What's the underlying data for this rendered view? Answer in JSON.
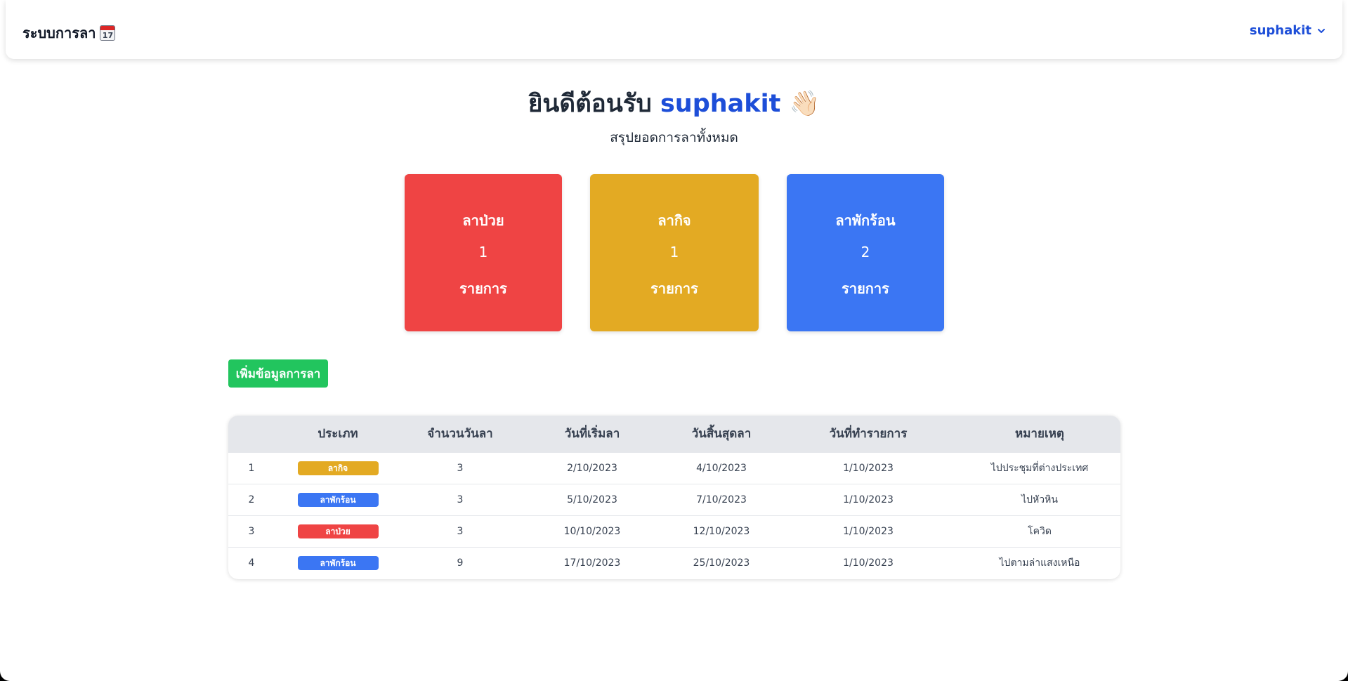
{
  "navbar": {
    "brand": "ระบบการลา",
    "brand_icon": "calendar-icon",
    "brand_icon_text": "17",
    "username": "suphakit"
  },
  "welcome": {
    "greeting": "ยินดีต้อนรับ",
    "username": "suphakit",
    "emoji": "👋🏻",
    "subtitle": "สรุปยอดการลาทั้งหมด"
  },
  "cards": [
    {
      "title": "ลาป่วย",
      "count": "1",
      "unit": "รายการ",
      "color": "#ef4444"
    },
    {
      "title": "ลากิจ",
      "count": "1",
      "unit": "รายการ",
      "color": "#e3aa23"
    },
    {
      "title": "ลาพักร้อน",
      "count": "2",
      "unit": "รายการ",
      "color": "#3b76f3"
    }
  ],
  "add_button": "เพิ่มข้อมูลการลา",
  "table": {
    "headers": [
      "",
      "ประเภท",
      "จำนวนวันลา",
      "วันที่เริ่มลา",
      "วันสิ้นสุดลา",
      "วันที่ทำรายการ",
      "หมายเหตุ"
    ],
    "rows": [
      {
        "no": "1",
        "type": "ลากิจ",
        "type_color": "#e3aa23",
        "days": "3",
        "start": "2/10/2023",
        "end": "4/10/2023",
        "created": "1/10/2023",
        "note": "ไปประชุมที่ต่างประเทศ"
      },
      {
        "no": "2",
        "type": "ลาพักร้อน",
        "type_color": "#3b76f3",
        "days": "3",
        "start": "5/10/2023",
        "end": "7/10/2023",
        "created": "1/10/2023",
        "note": "ไปหัวหิน"
      },
      {
        "no": "3",
        "type": "ลาป่วย",
        "type_color": "#ef4444",
        "days": "3",
        "start": "10/10/2023",
        "end": "12/10/2023",
        "created": "1/10/2023",
        "note": "โควิด"
      },
      {
        "no": "4",
        "type": "ลาพักร้อน",
        "type_color": "#3b76f3",
        "days": "9",
        "start": "17/10/2023",
        "end": "25/10/2023",
        "created": "1/10/2023",
        "note": "ไปตามล่าแสงเหนือ"
      }
    ]
  }
}
